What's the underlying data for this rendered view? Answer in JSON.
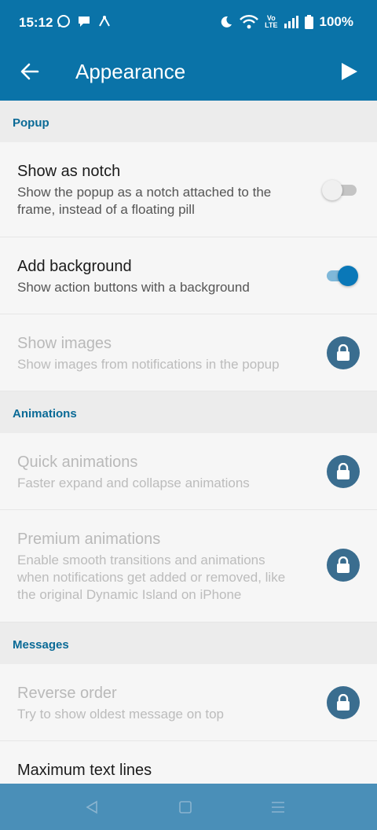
{
  "status_bar": {
    "time": "15:12",
    "battery": "100%",
    "network_label_top": "Vo",
    "network_label_bottom": "LTE"
  },
  "toolbar": {
    "title": "Appearance"
  },
  "sections": [
    {
      "header": "Popup",
      "items": [
        {
          "title": "Show as notch",
          "subtitle": "Show the popup as a notch attached to the frame, instead of a floating pill",
          "control": "toggle",
          "enabled": true,
          "value": false
        },
        {
          "title": "Add background",
          "subtitle": "Show action buttons with a background",
          "control": "toggle",
          "enabled": true,
          "value": true
        },
        {
          "title": "Show images",
          "subtitle": "Show images from notifications in the popup",
          "control": "lock",
          "enabled": false
        }
      ]
    },
    {
      "header": "Animations",
      "items": [
        {
          "title": "Quick animations",
          "subtitle": "Faster expand and collapse animations",
          "control": "lock",
          "enabled": false
        },
        {
          "title": "Premium animations",
          "subtitle": "Enable smooth transitions and animations when notifications get added or removed, like the original Dynamic Island on iPhone",
          "control": "lock",
          "enabled": false
        }
      ]
    },
    {
      "header": "Messages",
      "items": [
        {
          "title": "Reverse order",
          "subtitle": "Try to show oldest message on top",
          "control": "lock",
          "enabled": false
        },
        {
          "title": "Maximum text lines",
          "subtitle": "",
          "control": "none",
          "enabled": true
        }
      ]
    }
  ],
  "colors": {
    "app_bar": "#0a73a8",
    "accent": "#0a78b8",
    "section_header_text": "#0a6a96",
    "lock_badge": "#3a6d8f",
    "nav_bar": "#4a8fb8"
  },
  "icons": {
    "back": "arrow-left-icon",
    "action": "play-icon",
    "lock": "lock-icon",
    "nav_back": "triangle-back-icon",
    "nav_home": "square-home-icon",
    "nav_recents": "menu-lines-icon"
  }
}
